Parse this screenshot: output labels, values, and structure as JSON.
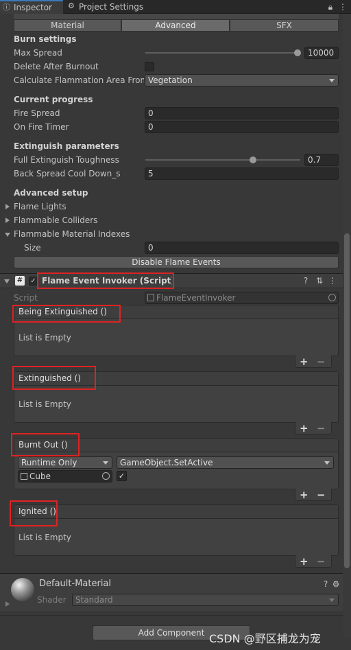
{
  "tabs": {
    "inspector": "Inspector",
    "project_settings": "Project Settings"
  },
  "top_toolbar": [
    "Material",
    "Advanced",
    "SFX"
  ],
  "burn_settings": {
    "header": "Burn settings",
    "max_spread_label": "Max Spread",
    "max_spread_value": "10000",
    "max_spread_level": 1.0,
    "delete_after_burnout_label": "Delete After Burnout",
    "calc_area_label": "Calculate Flammation Area From M",
    "calc_area_value": "Vegetation"
  },
  "current_progress": {
    "header": "Current progress",
    "fire_spread_label": "Fire Spread",
    "fire_spread_value": "0",
    "on_fire_timer_label": "On Fire Timer",
    "on_fire_timer_value": "0"
  },
  "extinguish": {
    "header": "Extinguish parameters",
    "full_toughness_label": "Full Extinguish Toughness",
    "full_toughness_value": "0.7",
    "full_toughness_level": 0.7,
    "back_spread_label": "Back Spread Cool Down_s",
    "back_spread_value": "5"
  },
  "advanced_setup": {
    "header": "Advanced setup",
    "flame_lights": "Flame Lights",
    "flammable_colliders": "Flammable Colliders",
    "flammable_material_indexes": "Flammable Material Indexes",
    "size_label": "Size",
    "size_value": "0",
    "disable_events_button": "Disable Flame Events"
  },
  "component": {
    "title": "Flame Event Invoker (Script)",
    "script_label": "Script",
    "script_value": "FlameEventInvoker"
  },
  "events": {
    "being_extinguished": "Being Extinguished ()",
    "extinguished": "Extinguished ()",
    "burnt_out": "Burnt Out ()",
    "ignited": "Ignited ()",
    "list_empty": "List is Empty",
    "runtime_mode": "Runtime Only",
    "function": "GameObject.SetActive",
    "target": "Cube",
    "plus": "+",
    "minus": "−"
  },
  "material": {
    "name": "Default-Material",
    "shader_label": "Shader",
    "shader_value": "Standard"
  },
  "add_component": "Add Component",
  "watermark": "CSDN @野区捕龙为宠",
  "colors": {
    "highlight_box": "#e02222",
    "accent": "#3a79bb"
  }
}
